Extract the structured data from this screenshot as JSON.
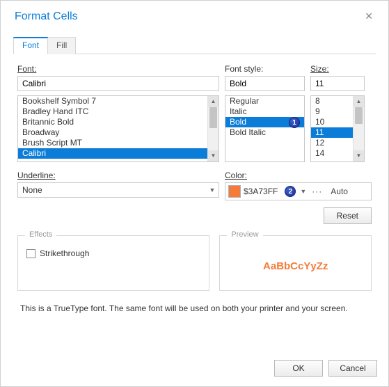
{
  "dialog": {
    "title": "Format Cells"
  },
  "tabs": {
    "font": "Font",
    "fill": "Fill"
  },
  "labels": {
    "font": "Font:",
    "style": "Font style:",
    "size": "Size:",
    "underline": "Underline:",
    "color": "Color:"
  },
  "font": {
    "value": "Calibri",
    "list": [
      "Bookshelf Symbol 7",
      "Bradley Hand ITC",
      "Britannic Bold",
      "Broadway",
      "Brush Script MT",
      "Calibri"
    ],
    "selected": "Calibri"
  },
  "style": {
    "value": "Bold",
    "list": [
      "Regular",
      "Italic",
      "Bold",
      "Bold Italic"
    ],
    "selected": "Bold"
  },
  "size": {
    "value": "11",
    "list": [
      "8",
      "9",
      "10",
      "11",
      "12",
      "14"
    ],
    "selected": "11"
  },
  "underline": {
    "value": "None"
  },
  "color": {
    "swatch": "#F47B3A",
    "hex": "$3A73FF",
    "auto": "Auto"
  },
  "buttons": {
    "reset": "Reset",
    "ok": "OK",
    "cancel": "Cancel"
  },
  "effects": {
    "legend": "Effects",
    "strike": "Strikethrough"
  },
  "preview": {
    "legend": "Preview",
    "sample": "AaBbCcYyZz",
    "color": "#F47B3A"
  },
  "footnote": "This is a TrueType font. The same font will be used on both your printer and your screen.",
  "badges": {
    "b1": "1",
    "b2": "2"
  }
}
